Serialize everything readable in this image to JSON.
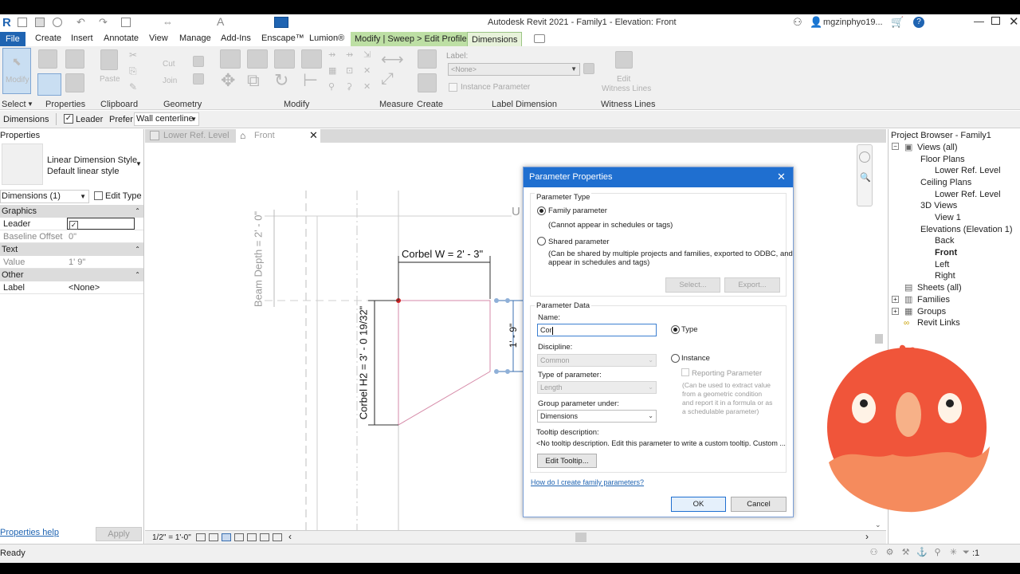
{
  "app": {
    "title": "Autodesk Revit 2021 - Family1 - Elevation: Front",
    "user": "mgzinphyo19...",
    "logo_letter": "R"
  },
  "menu": {
    "file": "File",
    "items": [
      "Create",
      "Insert",
      "Annotate",
      "View",
      "Manage",
      "Add-Ins",
      "Enscape™",
      "Lumion®"
    ],
    "context_tab": "Modify | Sweep > Edit Profile",
    "dimensions_tab": "Dimensions"
  },
  "ribbon": {
    "modify_label": "Modify",
    "paste_label": "Paste",
    "cut_label": "Cut",
    "join_label": "Join",
    "panels": [
      "Select",
      "Properties",
      "Clipboard",
      "Geometry",
      "Modify",
      "Measure",
      "Create",
      "Label Dimension",
      "Witness Lines"
    ],
    "label_caption": "Label:",
    "label_value": "<None>",
    "instance_parameter": "Instance Parameter",
    "edit_witness_lines": "Edit Witness Lines",
    "edit_witness_1": "Edit",
    "edit_witness_2": "Witness Lines"
  },
  "optionsbar": {
    "context": "Dimensions",
    "leader_label": "Leader",
    "leader_checked": true,
    "prefer_label": "Prefer:",
    "prefer_value": "Wall centerline"
  },
  "properties": {
    "title": "Properties",
    "type_line1": "Linear Dimension Style",
    "type_line2": "Default linear style",
    "selector": "Dimensions (1)",
    "edit_type": "Edit Type",
    "groups": {
      "graphics": "Graphics",
      "text": "Text",
      "other": "Other"
    },
    "rows": {
      "leader": "Leader",
      "baseline_offset": "Baseline Offset",
      "baseline_offset_value": "0\"",
      "value": "Value",
      "value_value": "1'  9\"",
      "label": "Label",
      "label_value": "<None>"
    },
    "help": "Properties help",
    "apply": "Apply"
  },
  "view_tabs": {
    "tab1": "Lower Ref. Level",
    "tab2": "Front"
  },
  "canvas": {
    "beam_depth": "Beam Depth = 2' - 0\"",
    "corbel_w": "Corbel W = 2' - 3\"",
    "corbel_h2": "Corbel H2 = 3' - 0 19/32\"",
    "dim_19": "1' - 9\"",
    "partial_u": "U"
  },
  "viewbar": {
    "scale": "1/2\" = 1'-0\""
  },
  "dialog": {
    "title": "Parameter Properties",
    "param_type": "Parameter Type",
    "family_param": "Family parameter",
    "family_param_note": "(Cannot appear in schedules or tags)",
    "shared_param": "Shared parameter",
    "shared_note1": "(Can be shared by multiple projects and families, exported to ODBC, and",
    "shared_note2": "appear in schedules and tags)",
    "select_btn": "Select...",
    "export_btn": "Export...",
    "param_data": "Parameter Data",
    "name_label": "Name:",
    "name_value": "Cor",
    "type_radio": "Type",
    "instance_radio": "Instance",
    "discipline_label": "Discipline:",
    "discipline_value": "Common",
    "reporting": "Reporting Parameter",
    "type_of_param_label": "Type of parameter:",
    "type_of_param_value": "Length",
    "reporting_note1": "(Can be used to extract value",
    "reporting_note2": "from a geometric condition",
    "reporting_note3": "and report it in a formula or as",
    "reporting_note4": "a schedulable parameter)",
    "group_under_label": "Group parameter under:",
    "group_under_value": "Dimensions",
    "tooltip_label": "Tooltip description:",
    "tooltip_value": "<No tooltip description. Edit this parameter to write a custom tooltip. Custom ...",
    "edit_tooltip": "Edit Tooltip...",
    "help_link": "How do I create family parameters?",
    "ok": "OK",
    "cancel": "Cancel"
  },
  "project_browser": {
    "title": "Project Browser - Family1",
    "views_all": "Views (all)",
    "floor_plans": "Floor Plans",
    "fp_lower": "Lower Ref. Level",
    "ceiling_plans": "Ceiling Plans",
    "cp_lower": "Lower Ref. Level",
    "views3d": "3D Views",
    "view1": "View 1",
    "elevations": "Elevations (Elevation 1)",
    "back": "Back",
    "front": "Front",
    "left": "Left",
    "right": "Right",
    "sheets": "Sheets (all)",
    "families": "Families",
    "groups": "Groups",
    "revit_links": "Revit Links"
  },
  "status": {
    "text": "Ready",
    "filter_count": ":1"
  },
  "colors": {
    "accent": "#1f64b2",
    "context_green": "#bddfa4",
    "dialog_title": "#1f6fd0",
    "mascot": "#f0553a"
  }
}
